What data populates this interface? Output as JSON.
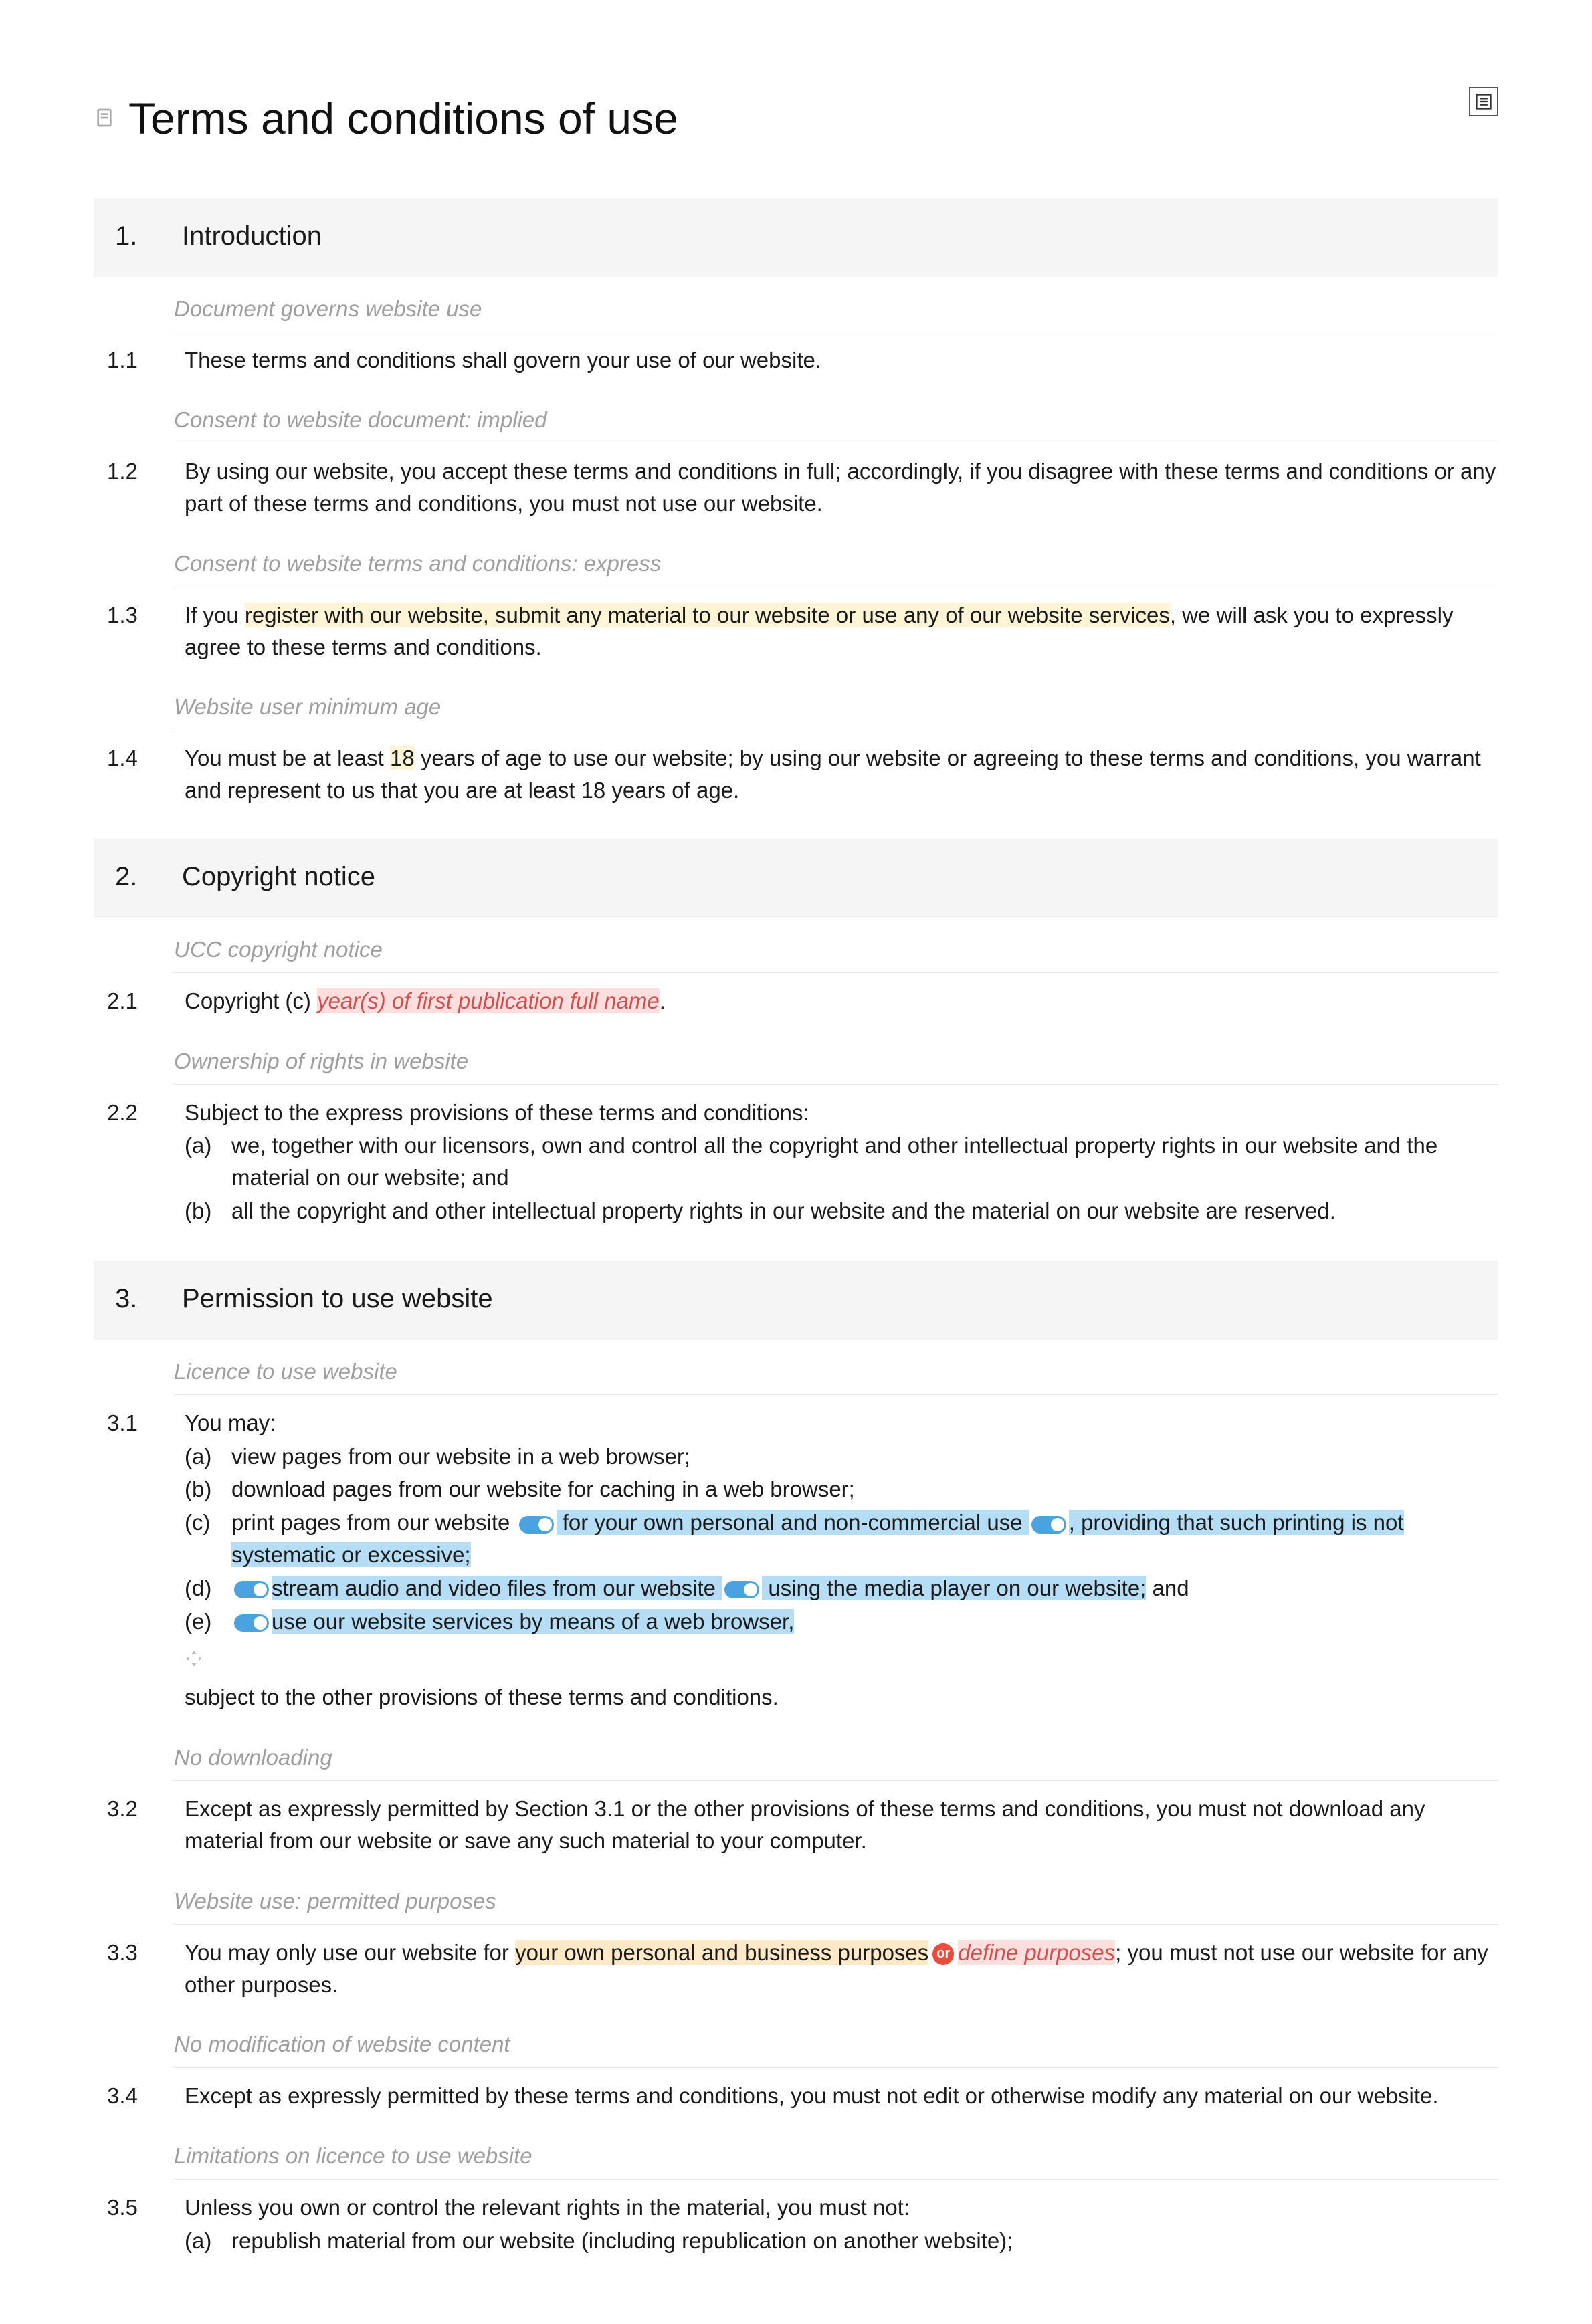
{
  "title": "Terms and conditions of use",
  "sections": {
    "s1": {
      "num": "1.",
      "heading": "Introduction"
    },
    "s2": {
      "num": "2.",
      "heading": "Copyright notice"
    },
    "s3": {
      "num": "3.",
      "heading": "Permission to use website"
    }
  },
  "notes": {
    "n1_1": "Document governs website use",
    "n1_2": "Consent to website document: implied",
    "n1_3": "Consent to website terms and conditions: express",
    "n1_4": "Website user minimum age",
    "n2_1": "UCC copyright notice",
    "n2_2": "Ownership of rights in website",
    "n3_1": "Licence to use website",
    "n3_2": "No downloading",
    "n3_3": "Website use: permitted purposes",
    "n3_4": "No modification of website content",
    "n3_5": "Limitations on licence to use website"
  },
  "clauses": {
    "c1_1": {
      "num": "1.1",
      "text": "These terms and conditions shall govern your use of our website."
    },
    "c1_2": {
      "num": "1.2",
      "text": "By using our website, you accept these terms and conditions in full; accordingly, if you disagree with these terms and conditions or any part of these terms and conditions, you must not use our website."
    },
    "c1_3": {
      "num": "1.3",
      "pre": "If you ",
      "hl": "register with our website, submit any material to our website or use any of our website services",
      "post": ", we will ask you to expressly agree to these terms and conditions."
    },
    "c1_4": {
      "num": "1.4",
      "pre": "You must be at least ",
      "hl": "18",
      "post": " years of age to use our website; by using our website or agreeing to these terms and conditions, you warrant and represent to us that you are at least 18 years of age."
    },
    "c2_1": {
      "num": "2.1",
      "pre": "Copyright (c) ",
      "hl": "year(s) of first publication full name",
      "post": "."
    },
    "c2_2": {
      "num": "2.2",
      "text": "Subject to the express provisions of these terms and conditions:",
      "a_label": "(a)",
      "a_text": "we, together with our licensors, own and control all the copyright and other intellectual property rights in our website and the material on our website; and",
      "b_label": "(b)",
      "b_text": "all the copyright and other intellectual property rights in our website and the material on our website are reserved."
    },
    "c3_1": {
      "num": "3.1",
      "text": "You may:",
      "a_label": "(a)",
      "a_text": "view pages from our website in a web browser;",
      "b_label": "(b)",
      "b_text": "download pages from our website for caching in a web browser;",
      "c_label": "(c)",
      "c_pre": "print pages from our website ",
      "c_hl1": " for your own personal and non-commercial use ",
      "c_hl2": ", providing that such printing is not systematic or excessive;",
      "d_label": "(d)",
      "d_hl1": "stream audio and video files from our website ",
      "d_hl2": " using the media player on our website;",
      "d_post": " and",
      "e_label": "(e)",
      "e_hl": "use our website services by means of a web browser,",
      "tail": "subject to the other provisions of these terms and conditions."
    },
    "c3_2": {
      "num": "3.2",
      "text": "Except as expressly permitted by Section 3.1 or the other provisions of these terms and conditions, you must not download any material from our website or save any such material to your computer."
    },
    "c3_3": {
      "num": "3.3",
      "pre": "You may only use our website for ",
      "hl1": "your own personal and business purposes",
      "or": "or",
      "hl2": "define purposes",
      "post": "; you must not use our website for any other purposes."
    },
    "c3_4": {
      "num": "3.4",
      "text": "Except as expressly permitted by these terms and conditions, you must not edit or otherwise modify any material on our website."
    },
    "c3_5": {
      "num": "3.5",
      "text": "Unless you own or control the relevant rights in the material, you must not:",
      "a_label": "(a)",
      "a_text": "republish material from our website (including republication on another website);"
    }
  }
}
